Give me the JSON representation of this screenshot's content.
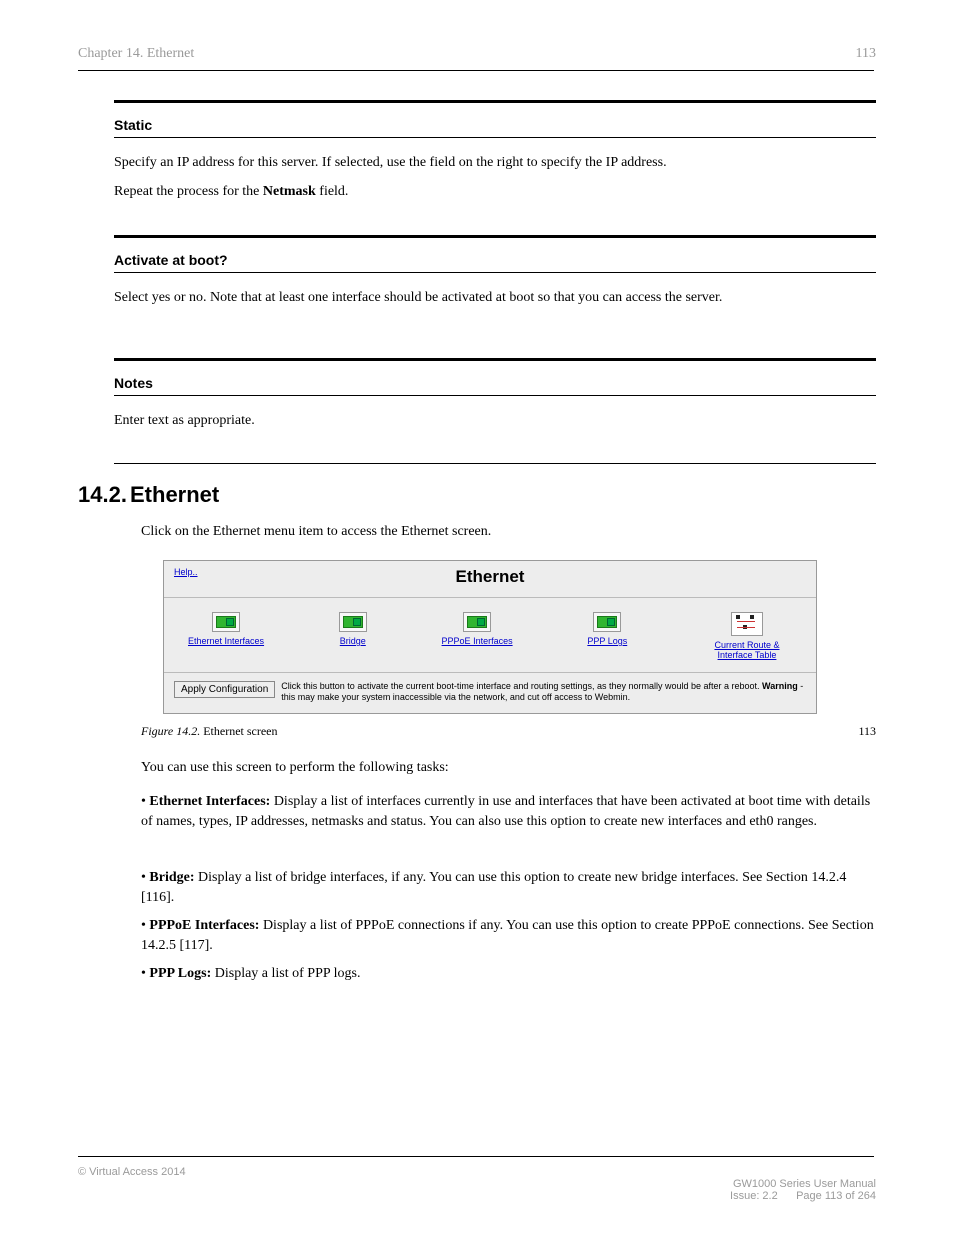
{
  "header": {
    "chapter": "Chapter 14.  Ethernet",
    "page_top": "113"
  },
  "box_static": {
    "label": "Static",
    "para1": "Specify an IP address for this server. If selected, use the field on the right to specify the IP address.",
    "para2_pre": "Repeat the process for the ",
    "para2_bold": "Netmask",
    "para2_post": " field."
  },
  "box_activate": {
    "label": "Activate at boot?",
    "para": "Select yes or no. Note that at least one interface should be activated at boot so that you can access the server."
  },
  "box_notes": {
    "label": "Notes",
    "para": "Enter text as appropriate."
  },
  "section": {
    "number": "14.2.",
    "title": "Ethernet"
  },
  "intro": "Click on the Ethernet menu item to access the Ethernet screen.",
  "screenshot": {
    "help": "Help..",
    "title": "Ethernet",
    "items": [
      "Ethernet Interfaces",
      "Bridge",
      "PPPoE Interfaces",
      "PPP Logs",
      "Current Route & Interface Table"
    ],
    "apply_label": "Apply Configuration",
    "apply_text_pre": "Click this button to activate the current boot-time interface and routing settings, as they normally would be after a reboot. ",
    "apply_text_bold": "Warning",
    "apply_text_post": " - this may make your system inaccessible via the network, and cut off access to Webmin."
  },
  "figure": {
    "label_italic": "Figure 14.2. ",
    "label_rest": "Ethernet screen",
    "number": "113"
  },
  "body2": "You can use this screen to perform the following tasks:",
  "list": {
    "item1_bold": "Ethernet Interfaces:",
    "item1_rest": " Display a list of interfaces currently in use and interfaces that have been activated at boot time with details of names, types, IP addresses, netmasks and status. You can also use this option to create new interfaces and eth0 ranges.",
    "item2_bold": "Bridge:",
    "item2_rest": " Display a list of bridge interfaces, if any. You can use this option to create new bridge interfaces. See Section 14.2.4 [116].",
    "item3_bold": "PPPoE Interfaces:",
    "item3_rest": " Display a list of PPPoE connections if any. You can use this option to create PPPoE connections. See Section 14.2.5 [117].",
    "item4_bold": "PPP Logs:",
    "item4_rest": " Display a list of PPP logs."
  },
  "footer": {
    "left": "© Virtual Access 2014",
    "right_prefix": "GW1000 Series User Manual\nIssue: 2.2         Page ",
    "right_page": "113",
    "right_suffix": " of 264"
  }
}
